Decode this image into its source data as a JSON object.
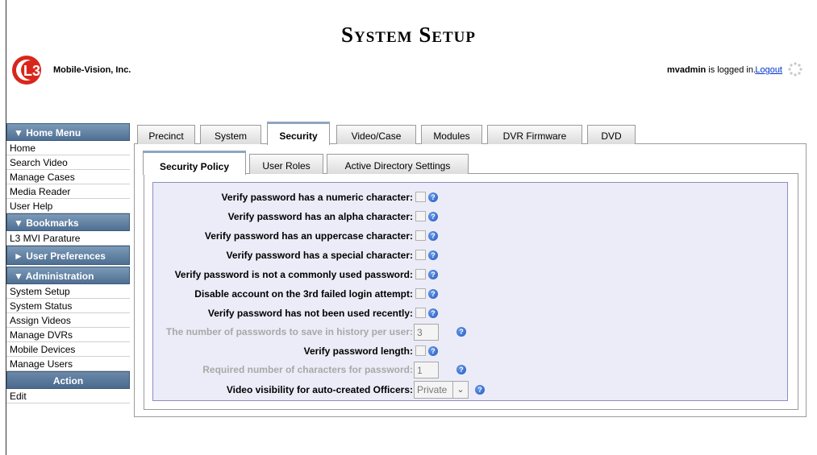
{
  "header": {
    "title": "System Setup",
    "company": "Mobile-Vision, Inc.",
    "logo_text": "L3",
    "username": "mvadmin",
    "logged_in_text": " is logged in.",
    "logout_label": "Logout"
  },
  "sidebar": {
    "home_menu": {
      "label": "▼ Home Menu",
      "items": [
        "Home",
        "Search Video",
        "Manage Cases",
        "Media Reader",
        "User Help"
      ]
    },
    "bookmarks": {
      "label": "▼ Bookmarks",
      "items": [
        "L3 MVI Parature"
      ]
    },
    "user_preferences": {
      "label": "► User Preferences"
    },
    "administration": {
      "label": "▼ Administration",
      "items": [
        "System Setup",
        "System Status",
        "Assign Videos",
        "Manage DVRs",
        "Mobile Devices",
        "Manage Users"
      ]
    },
    "action": {
      "label": "Action",
      "items": [
        "Edit"
      ]
    }
  },
  "tabs": [
    "Precinct",
    "System",
    "Security",
    "Video/Case",
    "Modules",
    "DVR Firmware",
    "DVD"
  ],
  "active_tab": "Security",
  "subtabs": [
    "Security Policy",
    "User Roles",
    "Active Directory Settings"
  ],
  "active_subtab": "Security Policy",
  "security_policy": {
    "numeric": {
      "label": "Verify password has a numeric character:",
      "checked": false
    },
    "alpha": {
      "label": "Verify password has an alpha character:",
      "checked": false
    },
    "uppercase": {
      "label": "Verify password has an uppercase character:",
      "checked": false
    },
    "special": {
      "label": "Verify password has a special character:",
      "checked": false
    },
    "common": {
      "label": "Verify password is not a commonly used password:",
      "checked": false
    },
    "lockout": {
      "label": "Disable account on the 3rd failed login attempt:",
      "checked": false
    },
    "recent": {
      "label": "Verify password has not been used recently:",
      "checked": false
    },
    "history_count": {
      "label": "The number of passwords to save in history per user:",
      "value": "3"
    },
    "length": {
      "label": "Verify password length:",
      "checked": false
    },
    "min_chars": {
      "label": "Required number of characters for password:",
      "value": "1"
    },
    "visibility": {
      "label": "Video visibility for auto-created Officers:",
      "value": "Private"
    }
  },
  "help_icon": "?"
}
